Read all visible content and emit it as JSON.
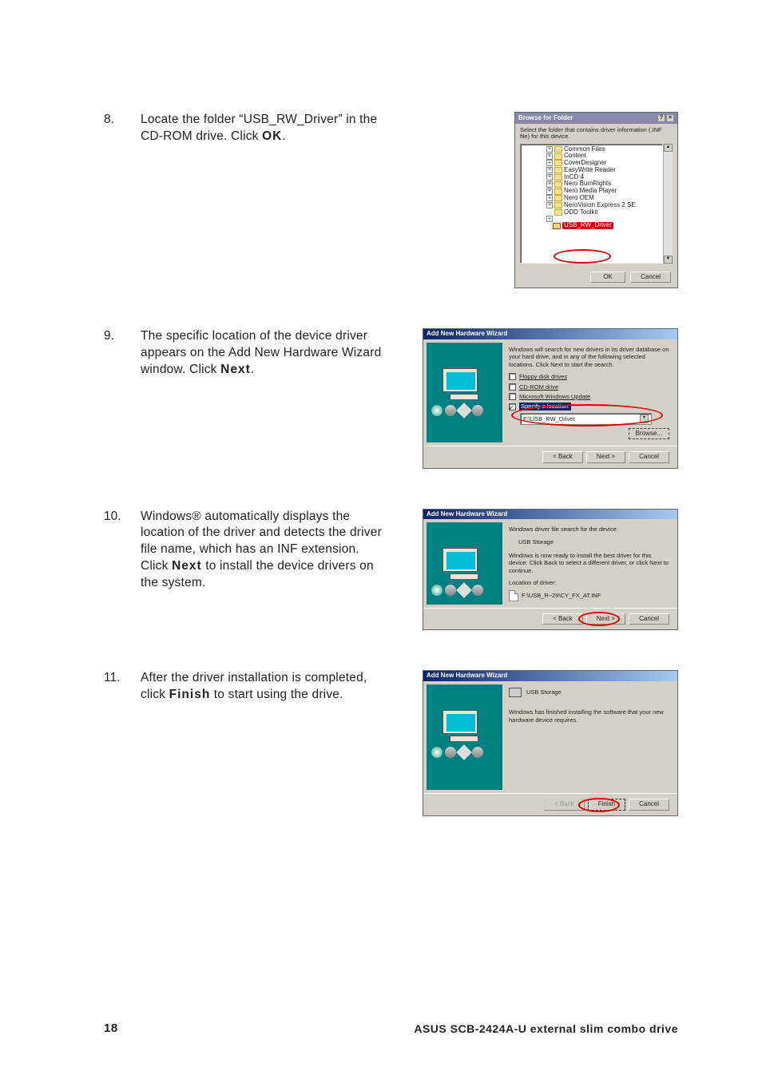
{
  "steps": {
    "s8": {
      "num": "8.",
      "text_a": "Locate the folder “USB_RW_Driver” in the CD-ROM drive. Click ",
      "bold": "OK",
      "text_b": "."
    },
    "s9": {
      "num": "9.",
      "text_a": "The specific location of the device driver appears on the Add New Hardware Wizard window. Click ",
      "bold": "Next",
      "text_b": "."
    },
    "s10": {
      "num": "10.",
      "text_a": "Windows® automatically displays the location of the driver and detects the driver file name, which has an INF extension. Click ",
      "bold": "Next",
      "text_b": " to install the device drivers on the system."
    },
    "s11": {
      "num": "11.",
      "text_a": "After the driver installation is completed, click ",
      "bold": "Finish",
      "text_b": " to start using the drive."
    }
  },
  "win8": {
    "title": "Browse for Folder",
    "instr": "Select the folder that contains driver information (.INF file) for this device.",
    "items": [
      "Common Files",
      "Content",
      "CoverDesigner",
      "EasyWrite Reader",
      "InCD 4",
      "Nero BurnRights",
      "Nero Media Player",
      "Nero OEM",
      "NeroVision Express 2 SE",
      "ODD Toolkit"
    ],
    "spacer": "",
    "highlight": "USB_RW_Driver",
    "ok": "OK",
    "cancel": "Cancel",
    "help": "?",
    "close": "×",
    "up": "▲",
    "down": "▼"
  },
  "win9": {
    "title": "Add New Hardware Wizard",
    "top": "Windows will search for new drivers in its driver database on your hard drive, and in any of the following selected locations. Click Next to start the search.",
    "opt1": "Floppy disk drives",
    "opt2": "CD-ROM drive",
    "opt3": "Microsoft Windows Update",
    "opt4": "Specify a location:",
    "path": "F:\\USB_RW_Driver",
    "browse": "Browse...",
    "back": "< Back",
    "next": "Next >",
    "cancel": "Cancel"
  },
  "win10": {
    "title": "Add New Hardware Wizard",
    "top": "Windows driver file search for the device:",
    "dev": "USB Storage",
    "mid": "Windows is now ready to install the best driver for this device. Click Back to select a different driver, or click Next to continue.",
    "loclabel": "Location of driver:",
    "path": "F:\\USB_R~29\\CY_FX_AT.INF",
    "back": "< Back",
    "next": "Next >",
    "cancel": "Cancel"
  },
  "win11": {
    "title": "Add New Hardware Wizard",
    "dev": "USB Storage",
    "msg": "Windows has finished installing the software that your new hardware device requires.",
    "back": "< Back",
    "finish": "Finish",
    "cancel": "Cancel"
  },
  "footer": {
    "page": "18",
    "title": "ASUS SCB-2424A-U external slim combo drive"
  },
  "glyphs": {
    "ddarrow": "▾"
  }
}
